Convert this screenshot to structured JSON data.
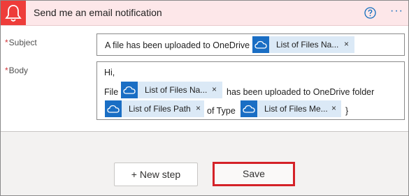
{
  "header": {
    "title": "Send me an email notification",
    "help_icon": "question-circle-icon",
    "more_icon": "ellipsis-icon",
    "more_glyph": "···",
    "accent": "#ee3d3a"
  },
  "subject": {
    "label": "Subject",
    "required_mark": "*",
    "prefix_text": "A file has been uploaded to OneDrive :",
    "token": {
      "label": "List of Files Na...",
      "icon": "onedrive-cloud-icon",
      "remove": "×"
    }
  },
  "body": {
    "label": "Body",
    "required_mark": "*",
    "greeting": "Hi,",
    "word_file": "File",
    "token_name": {
      "label": "List of Files Na...",
      "remove": "×"
    },
    "uploaded_text": "has been uploaded to OneDrive folder",
    "token_path": {
      "label": "List of Files Path",
      "remove": "×"
    },
    "of_type_text": "of Type",
    "token_media": {
      "label": "List of Files Me...",
      "remove": "×"
    },
    "closing_brace": "}"
  },
  "actions": {
    "new_step": "+ New step",
    "save": "Save"
  },
  "colors": {
    "token_bg": "#dbe9f6",
    "token_icon_bg": "#1a6ec4",
    "save_highlight": "#d42228"
  }
}
